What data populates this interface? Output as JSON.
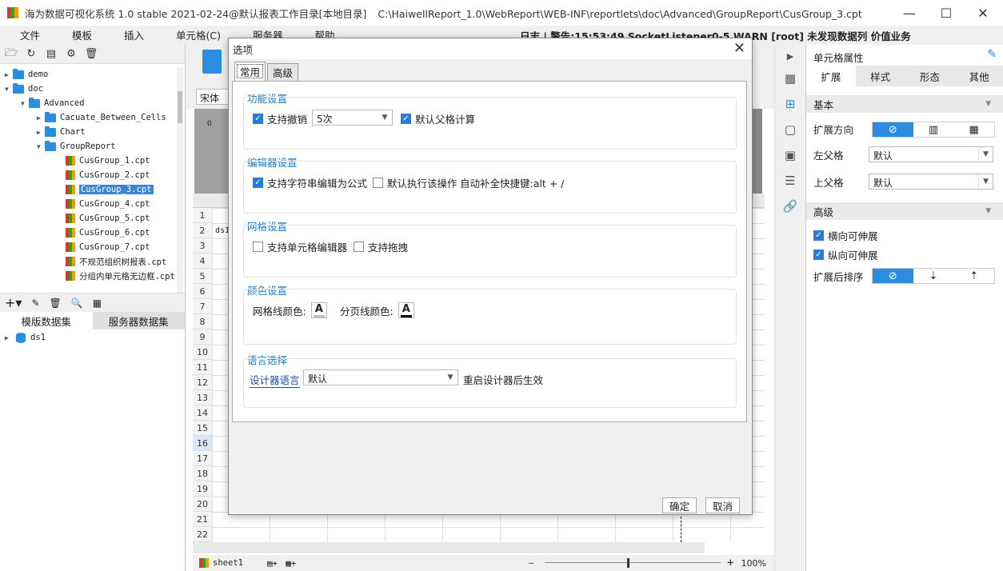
{
  "window": {
    "title": "海为数据可视化系统 1.0 stable 2021-02-24@默认报表工作目录[本地目录]",
    "path": "C:\\HaiwellReport_1.0\\WebReport\\WEB-INF\\reportlets\\doc\\Advanced\\GroupReport\\CusGroup_3.cpt",
    "minimize": "—",
    "maximize": "☐",
    "close": "✕"
  },
  "menu": {
    "items": [
      "文件",
      "模板",
      "插入",
      "单元格(C)",
      "服务器",
      "帮助"
    ],
    "log": "日志 | 警告:15:53:49 SocketListener0-5 WARN [root] 未发现数据列 价值业务"
  },
  "tree": {
    "demo": "demo",
    "doc": "doc",
    "advanced": "Advanced",
    "cacuate": "Cacuate_Between_Cells",
    "chart": "Chart",
    "groupreport": "GroupReport",
    "files": [
      "CusGroup_1.cpt",
      "CusGroup_2.cpt",
      "CusGroup_3.cpt",
      "CusGroup_4.cpt",
      "CusGroup_5.cpt",
      "CusGroup_6.cpt",
      "CusGroup_7.cpt",
      "不规范组织树报表.cpt",
      "分组内单元格无边框.cpt"
    ],
    "selected_index": 2
  },
  "datasets": {
    "tab_template": "模版数据集",
    "tab_server": "服务器数据集",
    "items": [
      "ds1"
    ]
  },
  "editor": {
    "font": "宋体",
    "ruler_zero": "0",
    "rows": [
      "1",
      "2",
      "3",
      "4",
      "5",
      "6",
      "7",
      "8",
      "9",
      "10",
      "11",
      "12",
      "13",
      "14",
      "15",
      "16",
      "17",
      "18",
      "19",
      "20",
      "21",
      "22"
    ],
    "highlight_row": "16",
    "cell_b2": "ds1",
    "sheet": "sheet1",
    "zoom": "100%",
    "zoom_minus": "—",
    "zoom_plus": "+"
  },
  "rightpanel": {
    "title": "单元格属性",
    "tabs": [
      "扩展",
      "样式",
      "形态",
      "其他"
    ],
    "basic": "基本",
    "expand_dir": "扩展方向",
    "left_parent": "左父格",
    "left_parent_value": "默认",
    "up_parent": "上父格",
    "up_parent_value": "默认",
    "advanced": "高级",
    "h_expand": "横向可伸展",
    "v_expand": "纵向可伸展",
    "sort_after": "扩展后排序"
  },
  "dialog": {
    "title": "选项",
    "tabs": [
      "常用",
      "高级"
    ],
    "func": {
      "title": "功能设置",
      "undo": "支持撤销",
      "undo_value": "5次",
      "parent_calc": "默认父格计算"
    },
    "editor": {
      "title": "编辑器设置",
      "formula": "支持字符串编辑为公式",
      "default_exec": "默认执行该操作",
      "autocomplete": "自动补全快捷键:alt + /"
    },
    "grid": {
      "title": "网格设置",
      "cell_editor": "支持单元格编辑器",
      "drag": "支持拖拽"
    },
    "color": {
      "title": "颜色设置",
      "gridline": "网格线颜色:",
      "pageline": "分页线颜色:",
      "glyph": "A",
      "gridline_color": "#c0c0c0",
      "pageline_color": "#000000"
    },
    "lang": {
      "title": "语言选择",
      "label": "设计器语言",
      "value": "默认",
      "note": "重启设计器后生效"
    },
    "ok": "确定",
    "cancel": "取消"
  }
}
